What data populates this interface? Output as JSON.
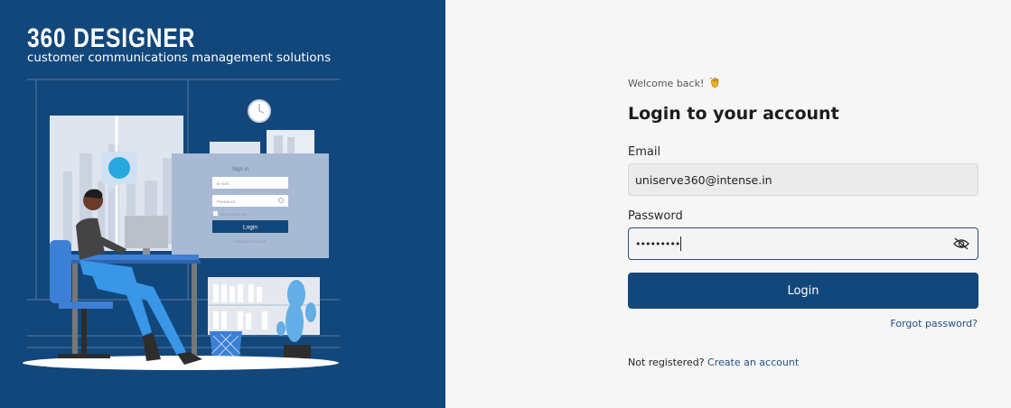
{
  "brand": {
    "title": "360 DESIGNER",
    "subtitle": "customer communications management solutions"
  },
  "illustration": {
    "signin_title": "Sign in",
    "email_placeholder": "E-mail",
    "password_placeholder": "Password",
    "remember_label": "Remember me",
    "login_label": "Login",
    "forgot_label": "Forgot Password?"
  },
  "login": {
    "welcome": "Welcome back!",
    "wave_icon": "waving-hand-icon",
    "heading": "Login to your account",
    "email_label": "Email",
    "email_value": "uniserve360@intense.in",
    "password_label": "Password",
    "password_mask": "•••••••••",
    "eye_icon": "eye-slash-icon",
    "login_button": "Login",
    "forgot_password": "Forgot password?",
    "not_registered": "Not registered?",
    "create_account": "Create an account"
  },
  "colors": {
    "brand_blue": "#12477b",
    "link_blue": "#1f4f86",
    "background": "#f6f6f6"
  }
}
